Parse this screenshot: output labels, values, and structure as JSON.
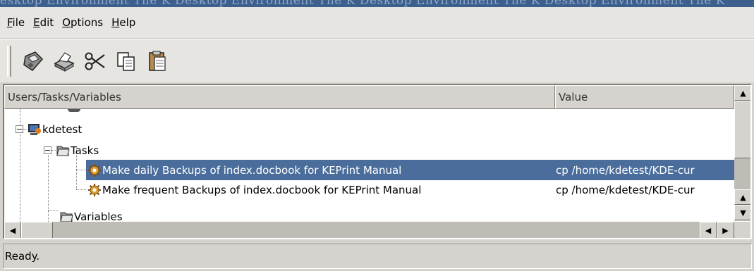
{
  "watermark": "esktop Environment The K Desktop Environment The K Desktop Environment The K Desktop Environment The K",
  "menu": [
    {
      "mnemonic": "F",
      "rest": "ile"
    },
    {
      "mnemonic": "E",
      "rest": "dit"
    },
    {
      "mnemonic": "O",
      "rest": "ptions"
    },
    {
      "mnemonic": "H",
      "rest": "elp"
    }
  ],
  "toolbar": {
    "items": [
      "save-icon",
      "print-icon",
      "cut-icon",
      "copy-icon",
      "paste-icon"
    ]
  },
  "list": {
    "columns": [
      "Users/Tasks/Variables",
      "Value"
    ],
    "rows": [
      {
        "name": "kdetest",
        "value": ""
      },
      {
        "name": "Tasks",
        "value": ""
      },
      {
        "name": "Make daily Backups of index.docbook for KEPrint Manual",
        "value": "cp  /home/kdetest/KDE-cur",
        "selected": true
      },
      {
        "name": "Make frequent Backups of index.docbook for KEPrint Manual",
        "value": "cp  /home/kdetest/KDE-cur"
      },
      {
        "name": "Variables",
        "value": ""
      }
    ]
  },
  "status": "Ready.",
  "colors": {
    "selection": "#4a6d9c",
    "background": "#d6d3ce"
  }
}
